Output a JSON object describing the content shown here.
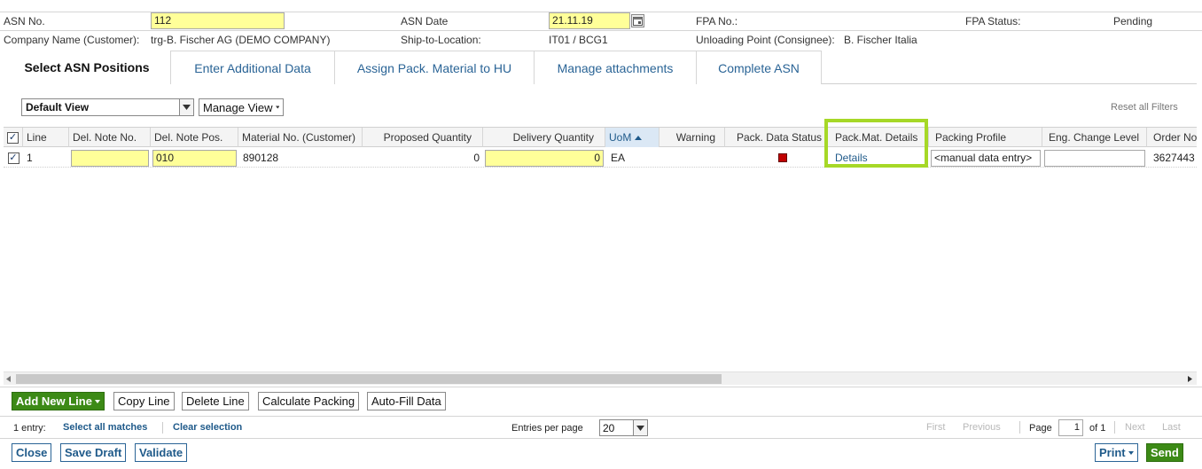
{
  "header": {
    "asn_no_label": "ASN No.",
    "asn_no_value": "112",
    "asn_date_label": "ASN Date",
    "asn_date_value": "21.11.19",
    "fpa_no_label": "FPA No.:",
    "fpa_status_label": "FPA Status:",
    "fpa_status_value": "Pending",
    "company_label": "Company Name (Customer):",
    "company_value": "trg-B. Fischer AG (DEMO COMPANY)",
    "ship_to_label": "Ship-to-Location:",
    "ship_to_value": "IT01 / BCG1",
    "unloading_label": "Unloading Point (Consignee):",
    "unloading_value": "B. Fischer Italia"
  },
  "tabs": [
    {
      "label": "Select ASN Positions",
      "active": true
    },
    {
      "label": "Enter Additional Data"
    },
    {
      "label": "Assign Pack. Material to HU"
    },
    {
      "label": "Manage attachments"
    },
    {
      "label": "Complete ASN"
    }
  ],
  "view": {
    "default_view": "Default View",
    "manage_view": "Manage View",
    "reset_filters": "Reset all Filters"
  },
  "grid": {
    "columns": [
      "Line",
      "Del. Note No.",
      "Del. Note Pos.",
      "Material No. (Customer)",
      "Proposed Quantity",
      "Delivery Quantity",
      "UoM",
      "Warning",
      "Pack. Data Status",
      "Pack.Mat. Details",
      "Packing Profile",
      "Eng. Change Level",
      "Order No"
    ],
    "rows": [
      {
        "line": "1",
        "del_note_no": "",
        "del_note_pos": "010",
        "material_no": "890128",
        "proposed_qty": "0",
        "delivery_qty": "0",
        "uom": "EA",
        "warning": "",
        "pack_status_color": "#c00000",
        "pack_mat_details": "Details",
        "packing_profile": "<manual data entry>",
        "eng_change_level": "",
        "order_no": "3627443"
      }
    ]
  },
  "actions": {
    "add_new_line": "Add New Line",
    "copy_line": "Copy Line",
    "delete_line": "Delete Line",
    "calculate_packing": "Calculate Packing",
    "auto_fill": "Auto-Fill Data"
  },
  "pager": {
    "entries": "1 entry:",
    "select_all": "Select all matches",
    "clear_selection": "Clear selection",
    "entries_per_page_label": "Entries per page",
    "entries_per_page_value": "20",
    "first": "First",
    "previous": "Previous",
    "page_label": "Page",
    "page_value": "1",
    "of": "of 1",
    "next": "Next",
    "last": "Last"
  },
  "footer": {
    "close": "Close",
    "save_draft": "Save Draft",
    "validate": "Validate",
    "print": "Print",
    "send": "Send"
  },
  "colors": {
    "accent_green": "#3c8a16",
    "highlight_green": "#a6d827",
    "required_yellow": "#ffff99",
    "link_blue": "#1f5a8a"
  }
}
